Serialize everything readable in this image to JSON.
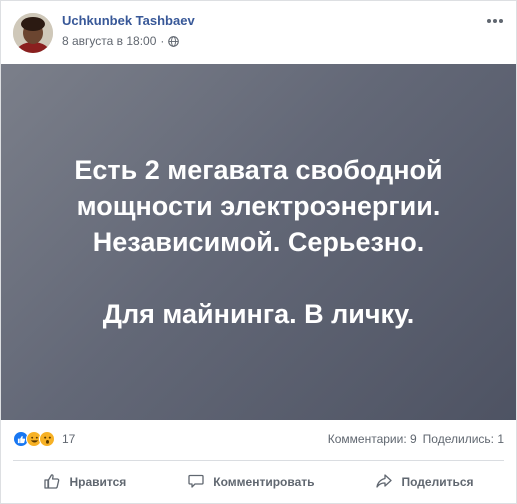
{
  "post": {
    "author": "Uchkunbek Tashbaev",
    "timestamp": "8 августа в 18:00",
    "privacy_icon": "globe-icon",
    "more_icon": "more-options-icon",
    "text_lines": [
      "Есть 2 мегавата свободной",
      "мощности электроэнергии.",
      "Независимой. Серьезно.",
      "Для майнинга. В личку."
    ],
    "background_colors": [
      "#7b7f8a",
      "#4e5363"
    ]
  },
  "stats": {
    "reaction_icons": [
      "like-icon",
      "haha-icon",
      "wow-icon"
    ],
    "reaction_count": "17",
    "comments": "Комментарии: 9",
    "shares": "Поделились: 1"
  },
  "actions": {
    "like": "Нравится",
    "comment": "Комментировать",
    "share": "Поделиться"
  },
  "colors": {
    "author_link": "#385898",
    "like_blue": "#1877f2",
    "emoji_yellow": "#f7b125"
  }
}
